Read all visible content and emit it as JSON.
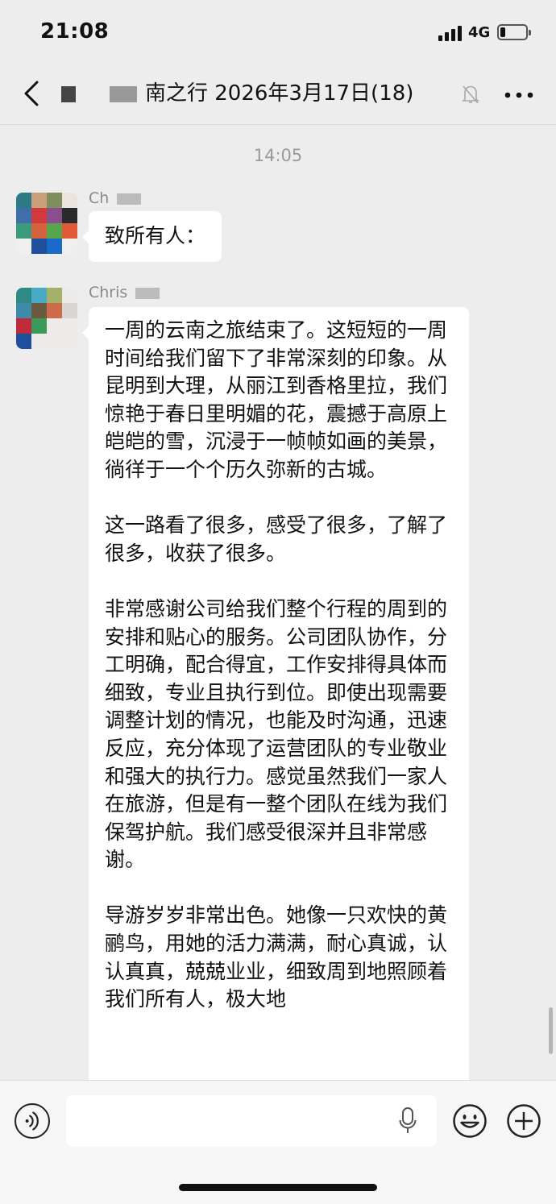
{
  "status_bar": {
    "time": "21:08",
    "network": "4G",
    "battery_level": 0.2
  },
  "nav": {
    "title_visible": "南之行 2026年3月17日(18)",
    "muted": true
  },
  "chat": {
    "timestamp": "14:05",
    "messages": [
      {
        "sender": "Ch",
        "paragraphs": [
          "致所有人："
        ]
      },
      {
        "sender": "Chris",
        "paragraphs": [
          "一周的云南之旅结束了。这短短的一周时间给我们留下了非常深刻的印象。从昆明到大理，从丽江到香格里拉，我们惊艳于春日里明媚的花，震撼于高原上皑皑的雪，沉浸于一帧帧如画的美景，徜徉于一个个历久弥新的古城。",
          "这一路看了很多，感受了很多，了解了很多，收获了很多。",
          "非常感谢公司给我们整个行程的周到的安排和贴心的服务。公司团队协作，分工明确，配合得宜，工作安排得具体而细致，专业且执行到位。即使出现需要调整计划的情况，也能及时沟通，迅速反应，充分体现了运营团队的专业敬业和强大的执行力。感觉虽然我们一家人在旅游，但是有一整个团队在线为我们保驾护航。我们感受很深并且非常感谢。",
          "导游岁岁非常出色。她像一只欢快的黄鹂鸟，用她的活力满满，耐心真诚，认认真真，兢兢业业，细致周到地照顾着我们所有人，极大地"
        ]
      }
    ]
  },
  "input_bar": {
    "icons": [
      "voice-icon",
      "microphone-icon",
      "emoji-icon",
      "plus-icon"
    ]
  },
  "colors": {
    "background": "#ededed",
    "bubble": "#ffffff",
    "timestamp": "#9a9a9a",
    "sender": "#8a8a8a"
  }
}
